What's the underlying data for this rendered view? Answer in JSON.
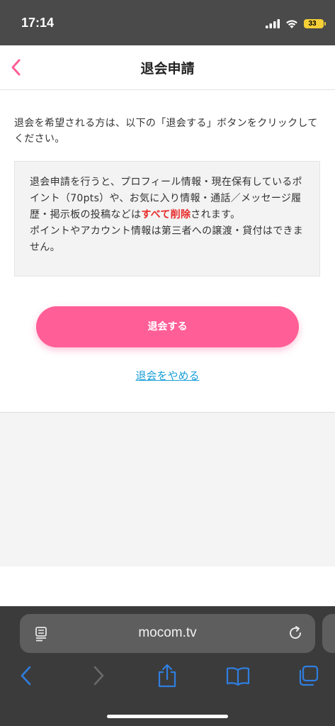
{
  "status_bar": {
    "time": "17:14",
    "battery": "33"
  },
  "header": {
    "title": "退会申請"
  },
  "content": {
    "intro": "退会を希望される方は、以下の「退会する」ボタンをクリックしてください。",
    "notice": {
      "line1_before": "退会申請を行うと、プロフィール情報・現在保有しているポイント（70pts）や、お気に入り情報・通話／メッセージ履歴・掲示板の投稿などは",
      "line1_emphasis": "すべて削除",
      "line1_after": "されます。",
      "line2": "ポイントやアカウント情報は第三者への譲渡・貸付はできません。"
    },
    "withdraw_button": "退会する",
    "cancel_link": "退会をやめる"
  },
  "browser": {
    "url": "mocom.tv"
  },
  "colors": {
    "accent_pink": "#ff5e96",
    "link_blue": "#1a9fd8",
    "warning_red": "#e82a2a",
    "browser_blue": "#2f7ee0"
  },
  "icons": {
    "back": "chevron-left-icon",
    "reader": "reader-mode-icon",
    "reload": "reload-icon",
    "nav_back": "nav-back-icon",
    "nav_forward": "nav-forward-icon",
    "share": "share-icon",
    "bookmarks": "bookmarks-icon",
    "tabs": "tabs-icon"
  }
}
